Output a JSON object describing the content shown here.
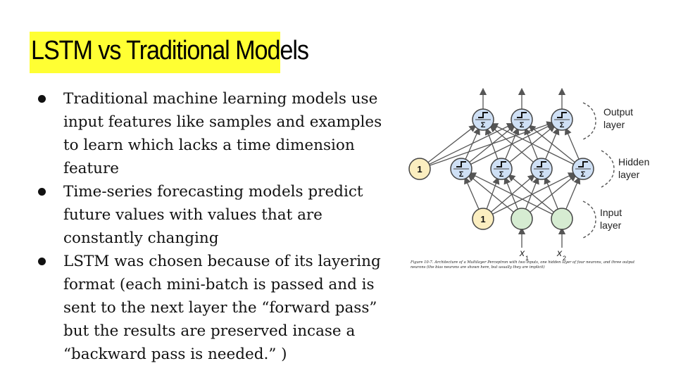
{
  "slide": {
    "title": "LSTM vs Traditional Models",
    "bullets": [
      "Traditional machine learning models use input features like samples and examples to learn which lacks a time dimension feature",
      "Time-series forecasting models predict future values with values that are constantly changing",
      "LSTM was chosen because of its layering format (each mini-batch is passed and is sent to the next layer the “forward pass” but the results are preserved incase a “backward pass is needed.” )"
    ]
  },
  "figure": {
    "layer_labels": {
      "output_line1": "Output",
      "output_line2": "layer",
      "hidden_line1": "Hidden",
      "hidden_line2": "layer",
      "input_line1": "Input",
      "input_line2": "layer"
    },
    "bias_label": "1",
    "sum_symbol": "Σ",
    "input_x1": "x",
    "input_x1_sub": "1",
    "input_x2": "x",
    "input_x2_sub": "2",
    "caption": "Figure 10-7. Architecture of a Multilayer Perceptron with two inputs, one hidden layer of four neurons, and three output neurons (the bias neurons are shown here, but usually they are implicit)",
    "colors": {
      "neuron_fill": "#cfe0f5",
      "bias_fill": "#fbeec0",
      "input_fill": "#d6ecd2",
      "edge": "#555555",
      "title_highlight": "#ffff33"
    }
  }
}
